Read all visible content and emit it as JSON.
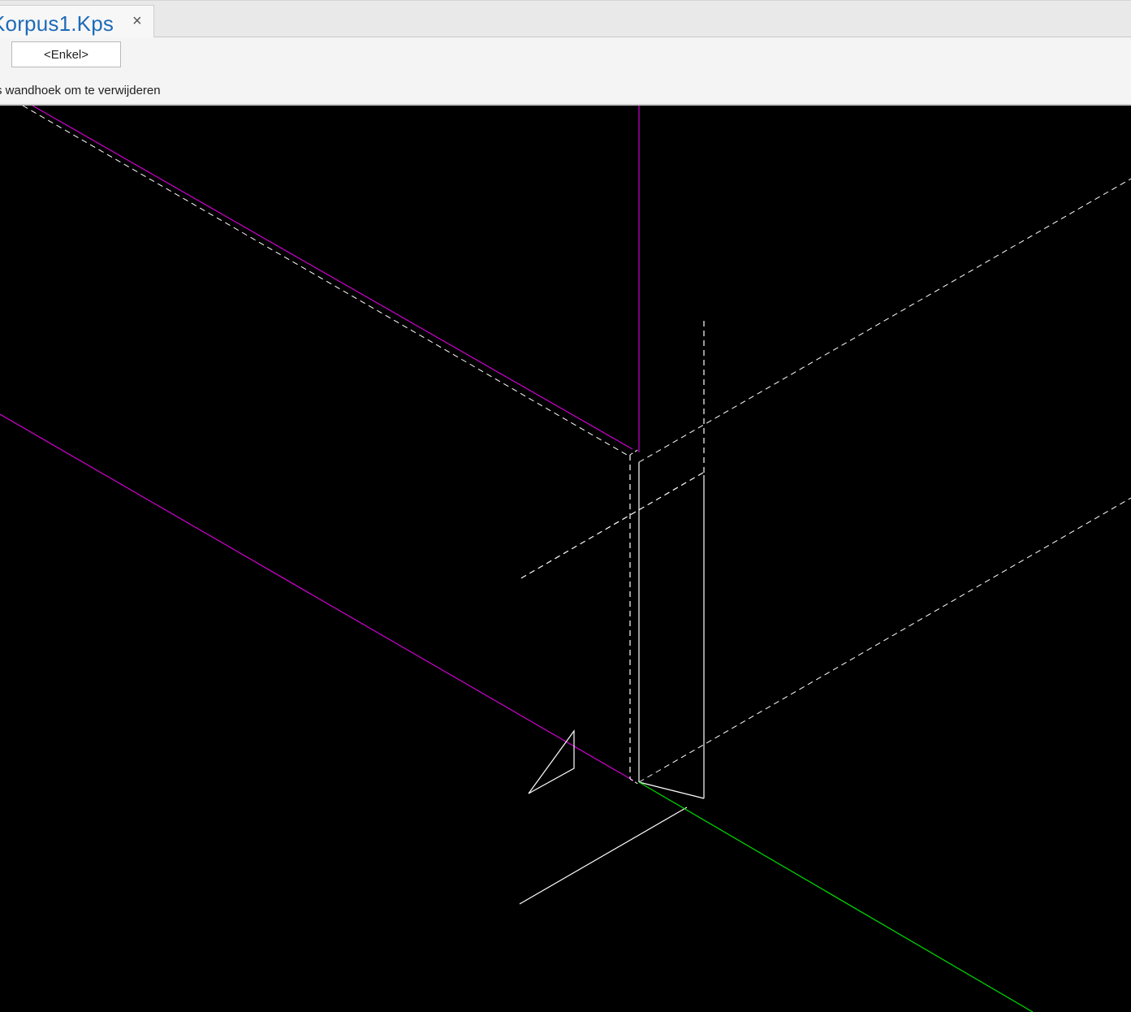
{
  "tab": {
    "title": "Korpus1.Kps",
    "close_glyph": "×",
    "close_icon": "close-icon"
  },
  "toolbar": {
    "mode_label": "<Enkel>"
  },
  "status": {
    "prompt": "s wandhoek om te verwijderen"
  },
  "viewport": {
    "background": "#000000",
    "colors": {
      "wall": "#d000d0",
      "outline": "#ffffff",
      "axis": "#00e000"
    }
  }
}
